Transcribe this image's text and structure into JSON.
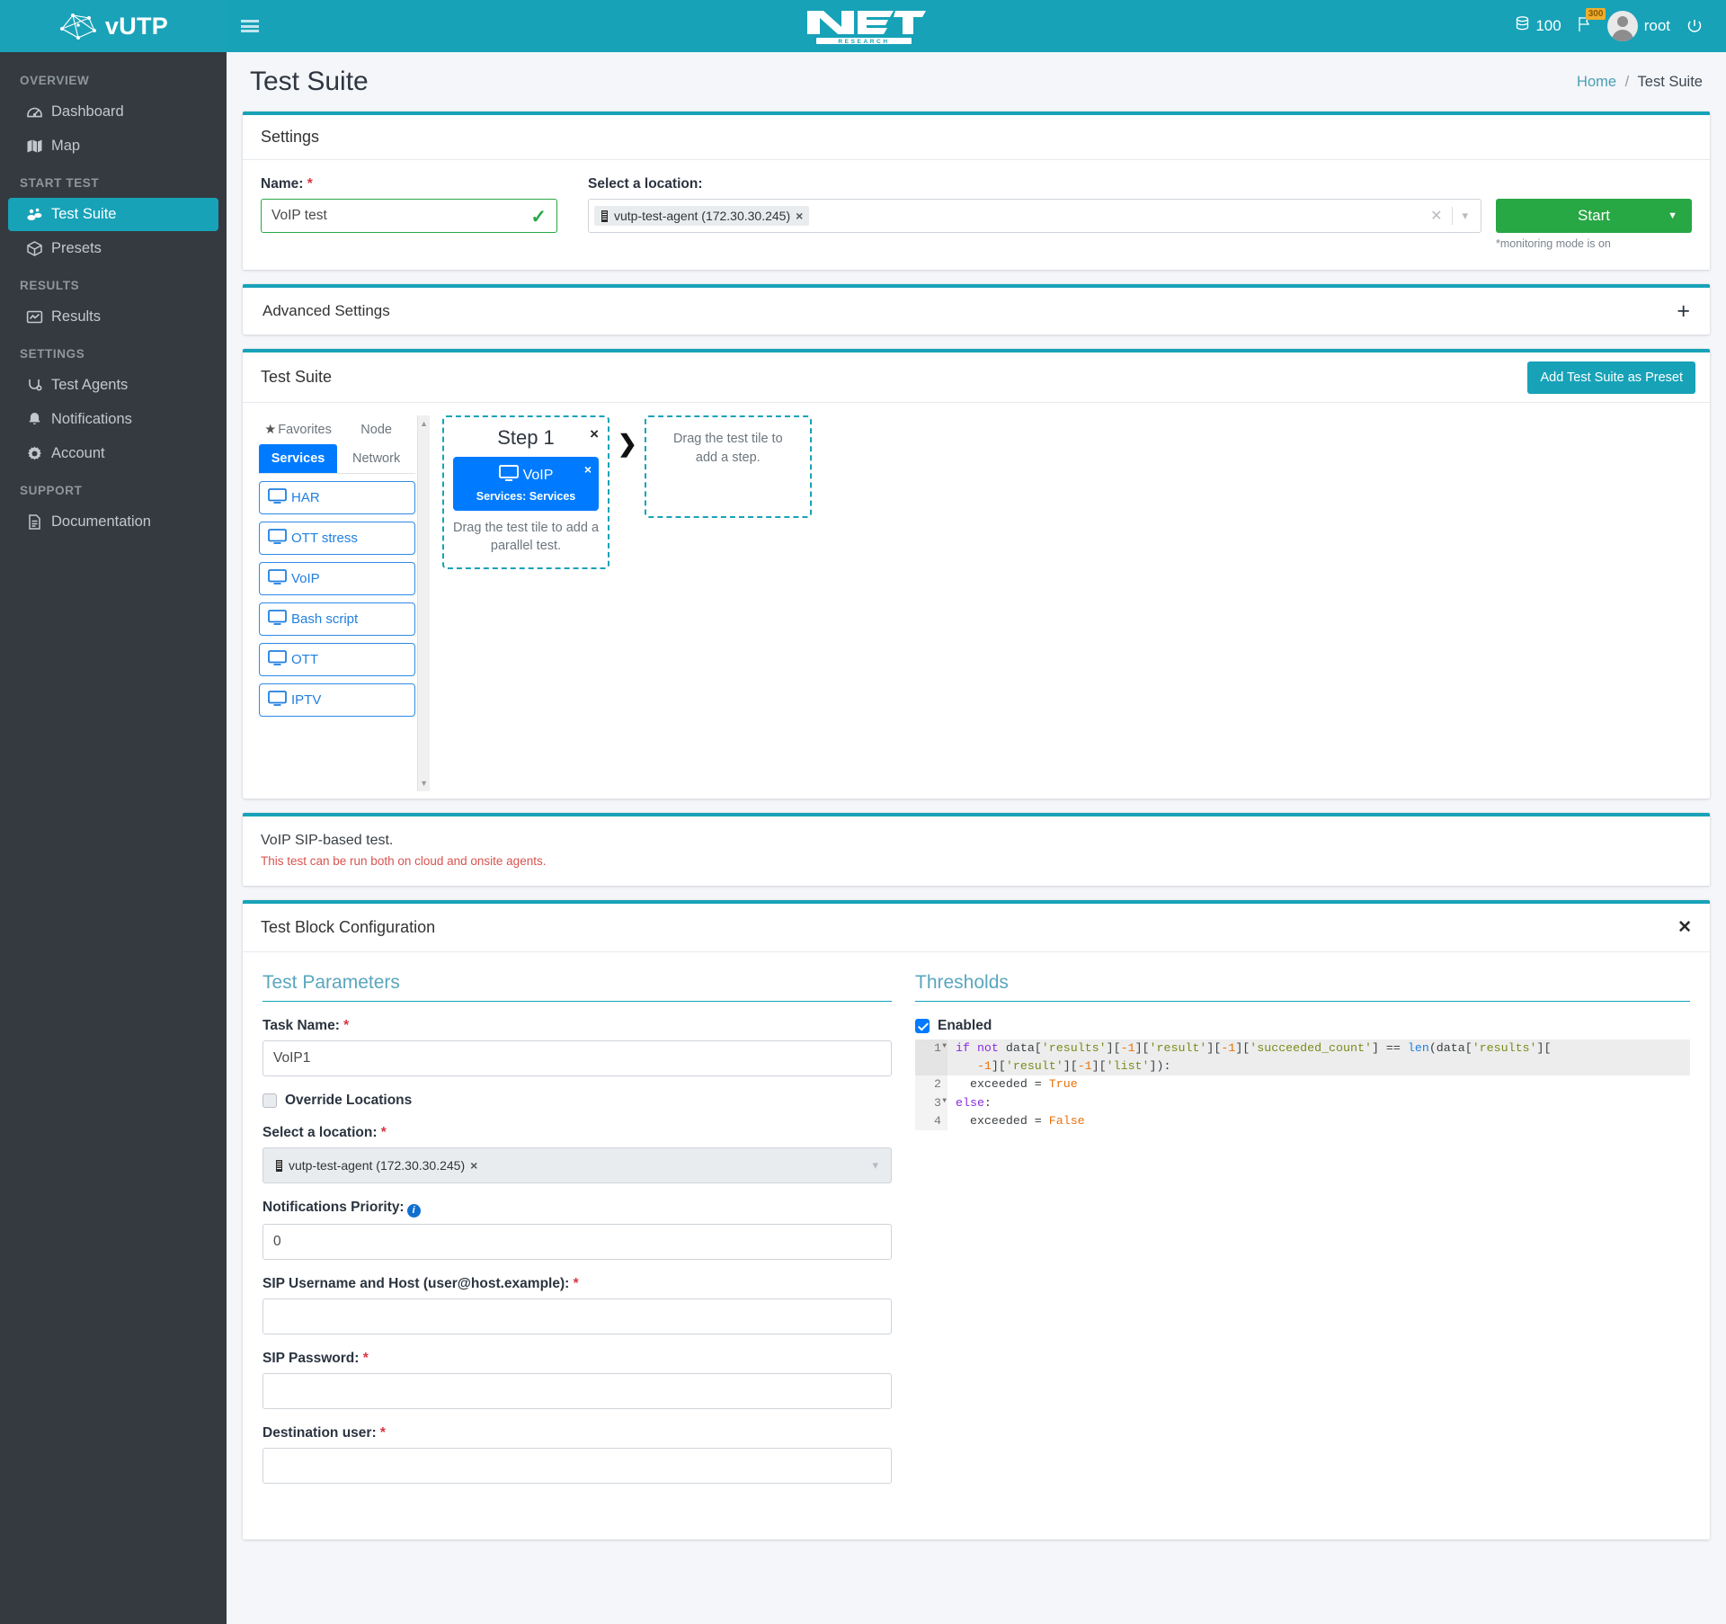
{
  "topbar": {
    "menu_icon": "hamburger-icon",
    "brand": "vUTP",
    "logo": "NET RESEARCH",
    "credits": "100",
    "flag_badge": "300",
    "username": "root",
    "power_icon": "power-icon"
  },
  "sidebar": {
    "groups": [
      {
        "header": "OVERVIEW",
        "items": [
          {
            "label": "Dashboard",
            "icon": "dashboard-icon",
            "active": false
          },
          {
            "label": "Map",
            "icon": "map-icon",
            "active": false
          }
        ]
      },
      {
        "header": "START TEST",
        "items": [
          {
            "label": "Test Suite",
            "icon": "test-suite-icon",
            "active": true
          },
          {
            "label": "Presets",
            "icon": "presets-icon",
            "active": false
          }
        ]
      },
      {
        "header": "RESULTS",
        "items": [
          {
            "label": "Results",
            "icon": "results-chart-icon",
            "active": false
          }
        ]
      },
      {
        "header": "SETTINGS",
        "items": [
          {
            "label": "Test Agents",
            "icon": "test-agents-icon",
            "active": false
          },
          {
            "label": "Notifications",
            "icon": "bell-icon",
            "active": false
          },
          {
            "label": "Account",
            "icon": "gear-icon",
            "active": false
          }
        ]
      },
      {
        "header": "SUPPORT",
        "items": [
          {
            "label": "Documentation",
            "icon": "document-icon",
            "active": false
          }
        ]
      }
    ]
  },
  "page": {
    "title": "Test Suite",
    "breadcrumb_home": "Home",
    "breadcrumb_sep": "/",
    "breadcrumb_current": "Test Suite"
  },
  "settings": {
    "card_title": "Settings",
    "name_label": "Name:",
    "name_value": "VoIP test",
    "name_placeholder": "",
    "location_label": "Select a location:",
    "location_chip": "vutp-test-agent (172.30.30.245)",
    "chip_remove": "×",
    "clear_icon": "clear-icon",
    "caret_icon": "chevron-down-icon",
    "start_label": "Start",
    "start_caret": "caret-down-icon",
    "monitoring_note": "*monitoring mode is on"
  },
  "advanced": {
    "title": "Advanced Settings",
    "expand_icon": "plus-icon"
  },
  "testsuite": {
    "card_title": "Test Suite",
    "preset_button": "Add Test Suite as Preset",
    "tabs_top": [
      {
        "label": "Favorites",
        "icon": "star-icon",
        "active": false
      },
      {
        "label": "Node",
        "icon": "",
        "active": false
      }
    ],
    "tabs_bottom": [
      {
        "label": "Services",
        "icon": "",
        "active": true
      },
      {
        "label": "Network",
        "icon": "",
        "active": false
      }
    ],
    "tiles": [
      {
        "label": "HAR",
        "icon": "monitor-icon"
      },
      {
        "label": "OTT stress",
        "icon": "monitor-icon"
      },
      {
        "label": "VoIP",
        "icon": "monitor-icon"
      },
      {
        "label": "Bash script",
        "icon": "monitor-icon"
      },
      {
        "label": "OTT",
        "icon": "monitor-icon"
      },
      {
        "label": "IPTV",
        "icon": "monitor-icon"
      }
    ],
    "scroll_up": "▲",
    "scroll_down": "▼",
    "step": {
      "title": "Step 1",
      "close": "×",
      "tile_label": "VoIP",
      "tile_icon": "monitor-icon",
      "tile_sub": "Services: Services",
      "tile_close": "×",
      "hint": "Drag the test tile to add a parallel test."
    },
    "arrow_icon": "chevron-right-icon",
    "dropzone_hint": "Drag the test tile to add a step."
  },
  "description": {
    "line1": "VoIP SIP-based test.",
    "line2": "This test can be run both on cloud and onsite agents."
  },
  "blockconfig": {
    "title": "Test Block Configuration",
    "close": "×",
    "params_title": "Test Parameters",
    "task_name_label": "Task Name:",
    "task_name_value": "VoIP1",
    "override_label": "Override Locations",
    "override_checked": false,
    "location_label": "Select a location:",
    "location_chip": "vutp-test-agent (172.30.30.245)",
    "chip_remove": "×",
    "caret_icon": "chevron-down-icon",
    "notif_label": "Notifications Priority:",
    "notif_info_icon": "info-icon",
    "notif_value": "0",
    "sip_user_label": "SIP Username and Host (user@host.example):",
    "sip_user_value": "",
    "sip_pass_label": "SIP Password:",
    "sip_pass_value": "",
    "dest_user_label": "Destination user:",
    "dest_user_value": "",
    "required_mark": "*"
  },
  "thresholds": {
    "title": "Thresholds",
    "enabled_label": "Enabled",
    "enabled_checked": true,
    "code_lines": [
      {
        "num": "1",
        "fold": true,
        "highlight": true
      },
      {
        "num": "2",
        "fold": false,
        "highlight": false
      },
      {
        "num": "3",
        "fold": true,
        "highlight": false
      },
      {
        "num": "4",
        "fold": false,
        "highlight": false
      }
    ],
    "code_text": "if not data['results'][-1]['result'][-1]['succeeded_count'] == len(data['results'][-1]['result'][-1]['list']):\n  exceeded = True\nelse:\n  exceeded = False"
  },
  "colors": {
    "teal": "#17a2b8",
    "sidebar": "#343a40",
    "green": "#28a745",
    "blue": "#007bff",
    "red": "#d9534f",
    "page_bg": "#f4f6f9"
  }
}
